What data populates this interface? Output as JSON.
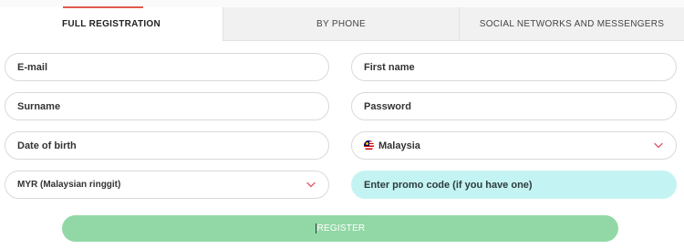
{
  "tabs": [
    {
      "label": "FULL REGISTRATION",
      "active": true
    },
    {
      "label": "BY PHONE",
      "active": false
    },
    {
      "label": "SOCIAL NETWORKS AND MESSENGERS",
      "active": false
    }
  ],
  "form": {
    "email_placeholder": "E-mail",
    "first_name_placeholder": "First name",
    "surname_placeholder": "Surname",
    "password_placeholder": "Password",
    "dob_placeholder": "Date of birth",
    "country_value": "Malaysia",
    "country_flag": "malaysia-flag-icon",
    "currency_value": "MYR (Malaysian ringgit)",
    "promo_placeholder": "Enter promo code (if you have one)"
  },
  "register_label": "REGISTER",
  "colors": {
    "accent": "#e05a4e",
    "register_bg": "#92d8a6",
    "promo_bg": "#c4f3f3",
    "chevron": "#e05a6b"
  }
}
